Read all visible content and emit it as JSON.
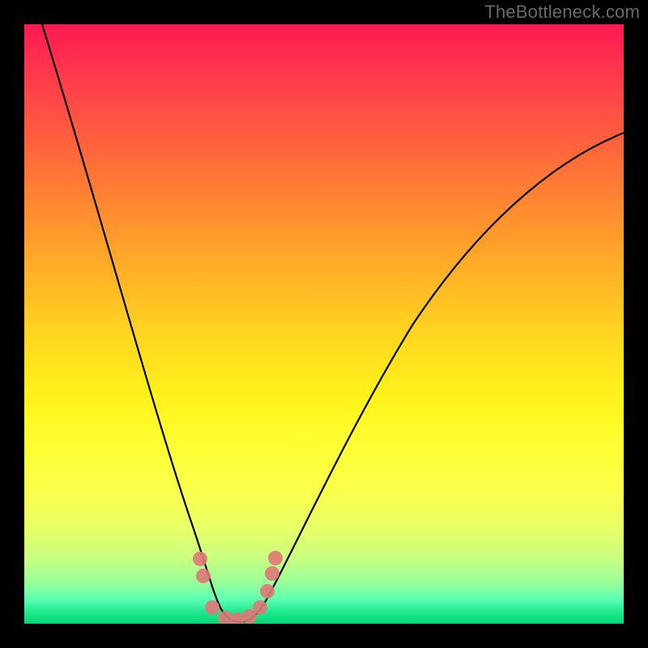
{
  "watermark": "TheBottleneck.com",
  "chart_data": {
    "type": "line",
    "title": "",
    "xlabel": "",
    "ylabel": "",
    "xlim": [
      0,
      100
    ],
    "ylim": [
      0,
      100
    ],
    "grid": false,
    "legend": false,
    "series": [
      {
        "name": "bottleneck-curve",
        "x": [
          3,
          8,
          14,
          19,
          24,
          27,
          29,
          31,
          33,
          35,
          37,
          40,
          45,
          52,
          60,
          70,
          82,
          92,
          100
        ],
        "y": [
          100,
          82,
          62,
          44,
          26,
          15,
          8,
          3,
          1,
          1,
          3,
          8,
          19,
          33,
          47,
          59,
          70,
          77,
          82
        ]
      }
    ],
    "markers": {
      "name": "highlight-dots",
      "x": [
        27.5,
        28.5,
        30,
        32,
        34,
        36,
        37.2,
        38.2
      ],
      "y": [
        10,
        6,
        2,
        1,
        1,
        2.5,
        6,
        10
      ]
    },
    "background_gradient": {
      "top": "#ff1a53",
      "mid": "#fff21a",
      "bottom": "#00d873"
    }
  }
}
